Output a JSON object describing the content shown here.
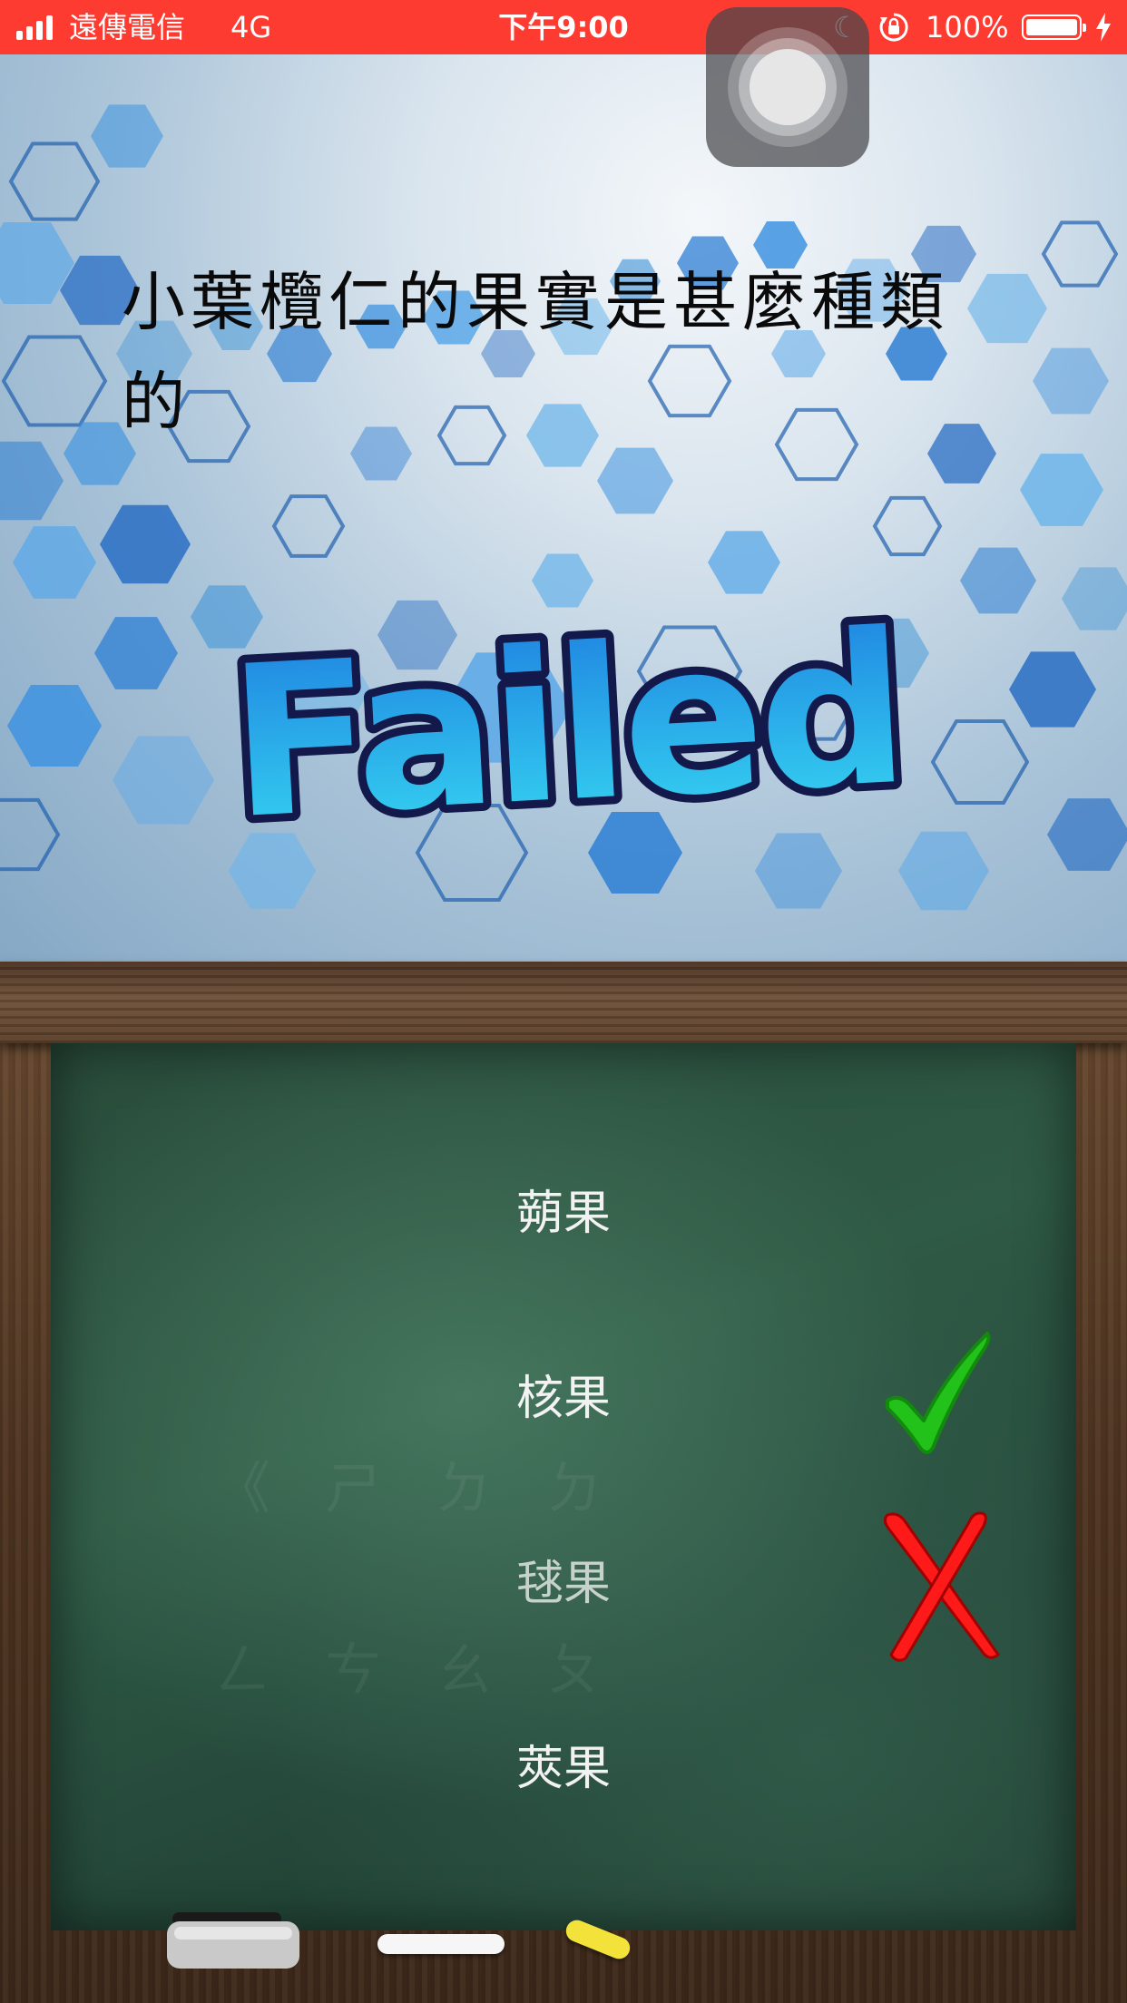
{
  "status_bar": {
    "carrier": "遠傳電信",
    "network": "4G",
    "time": "下午9:00",
    "battery_percent": "100%",
    "battery_level": 1.0,
    "background_color": "#fe3b30",
    "icons": [
      "signal-icon",
      "moon-icon",
      "orientation-lock-icon",
      "battery-icon",
      "charging-bolt-icon"
    ]
  },
  "assistive_touch": {
    "icon": "assistive-touch-icon"
  },
  "question": {
    "text": "小葉欖仁的果實是甚麼種類的"
  },
  "result": {
    "banner": "Failed",
    "colors": {
      "fill_top": "#1e7fe0",
      "fill_bottom": "#37d9f2",
      "outline": "#13194a"
    }
  },
  "answers": {
    "options": [
      {
        "label": "蒴果",
        "state": "none"
      },
      {
        "label": "核果",
        "state": "correct"
      },
      {
        "label": "毬果",
        "state": "wrong"
      },
      {
        "label": "莢果",
        "state": "none"
      }
    ],
    "correct_color": "#22c21a",
    "wrong_color": "#ff1a1a"
  },
  "chalkboard": {
    "ghost_text_row1": "《ㄕㄉㄉ",
    "ghost_text_row2": "ㄥㄘㄠㄆ",
    "tray": [
      "eraser",
      "white-chalk",
      "yellow-chalk"
    ]
  }
}
